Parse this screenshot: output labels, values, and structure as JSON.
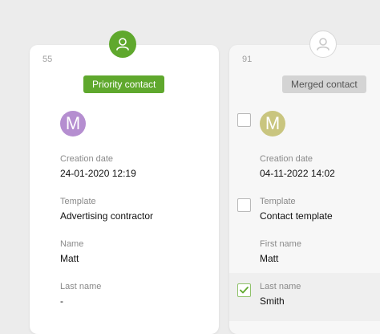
{
  "left_card": {
    "id": "55",
    "badge": "Priority contact",
    "initial": "M",
    "fields": [
      {
        "label": "Creation date",
        "value": "24-01-2020 12:19"
      },
      {
        "label": "Template",
        "value": "Advertising contractor"
      },
      {
        "label": "Name",
        "value": "Matt"
      },
      {
        "label": "Last name",
        "value": "-"
      }
    ]
  },
  "right_card": {
    "id": "91",
    "badge": "Merged contact",
    "initial": "M",
    "fields": [
      {
        "label": "Creation date",
        "value": "04-11-2022 14:02"
      },
      {
        "label": "Template",
        "value": "Contact template"
      },
      {
        "label": "First name",
        "value": "Matt"
      },
      {
        "label": "Last name",
        "value": "Smith"
      }
    ]
  },
  "icons": {
    "left_avatar": "user-icon",
    "right_avatar": "user-icon",
    "check": "checkmark-icon"
  },
  "colors": {
    "accent_green": "#5fa82d",
    "left_initial_bg": "#b58ed0",
    "right_initial_bg": "#c9c57f",
    "merged_badge_bg": "#d4d4d4"
  }
}
